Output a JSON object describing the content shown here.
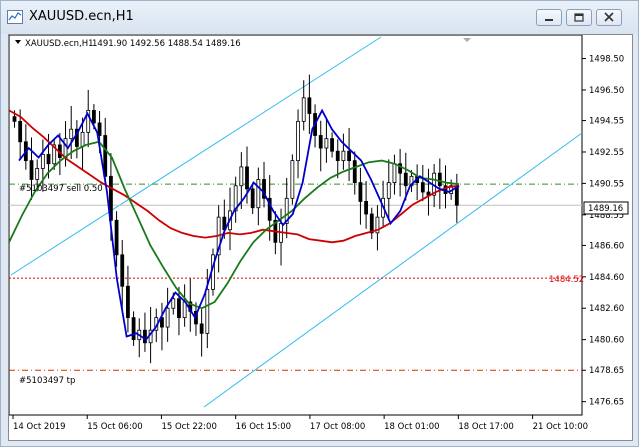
{
  "window": {
    "title": "XAUUSD.ecn,H1",
    "buttons": [
      "minimize",
      "restore",
      "close"
    ]
  },
  "chart_info": {
    "symbol_tf": "XAUUSD.ecn,H1",
    "ohlc": "1491.90 1492.56 1488.54 1489.16"
  },
  "order_lines": {
    "sell_label": "#5103497 sell 0.50",
    "tp_label": "#5103497 tp"
  },
  "price_labels": {
    "current": "1489.16",
    "alert": "1484.52"
  },
  "colors": {
    "candle": "#000000",
    "ma_red": "#cc0000",
    "ma_green": "#1a7a1a",
    "ma_blue": "#0000cc",
    "channel": "#33bbee",
    "sell_line": "#2f8f2f",
    "tp_line": "#cc3300",
    "alert_line": "#dd0000"
  },
  "chart_data": {
    "type": "candlestick",
    "symbol": "XAUUSD.ecn",
    "timeframe": "H1",
    "ylim": [
      1475.8,
      1500.0
    ],
    "y_ticks": [
      "1498.50",
      "1496.50",
      "1494.55",
      "1492.55",
      "1490.55",
      "1488.55",
      "1486.60",
      "1484.60",
      "1482.60",
      "1480.60",
      "1478.65",
      "1476.65"
    ],
    "x_ticks": [
      "14 Oct 2019",
      "15 Oct 06:00",
      "15 Oct 22:00",
      "16 Oct 15:00",
      "17 Oct 08:00",
      "18 Oct 01:00",
      "18 Oct 17:00",
      "21 Oct 10:00"
    ],
    "current_price": 1489.16,
    "levels": {
      "sell_entry": 1490.5,
      "take_profit": 1478.65,
      "alert": 1484.52,
      "current": 1489.16
    },
    "closes": [
      1494.5,
      1493.2,
      1492.0,
      1490.8,
      1491.5,
      1492.4,
      1491.8,
      1493.0,
      1492.2,
      1493.4,
      1494.0,
      1492.9,
      1493.8,
      1495.2,
      1494.4,
      1493.6,
      1491.0,
      1488.2,
      1486.0,
      1484.0,
      1482.0,
      1480.6,
      1481.2,
      1480.4,
      1481.2,
      1482.0,
      1481.4,
      1482.6,
      1483.2,
      1482.0,
      1483.0,
      1482.4,
      1481.6,
      1481.0,
      1483.8,
      1486.0,
      1488.4,
      1487.6,
      1488.8,
      1490.4,
      1491.6,
      1490.2,
      1489.0,
      1490.8,
      1489.6,
      1488.2,
      1486.8,
      1488.0,
      1489.6,
      1492.0,
      1494.5,
      1496.0,
      1495.0,
      1493.6,
      1492.8,
      1493.4,
      1492.6,
      1492.0,
      1492.6,
      1492.0,
      1490.6,
      1489.4,
      1488.6,
      1487.4,
      1488.4,
      1489.6,
      1490.6,
      1491.8,
      1491.2,
      1490.4,
      1491.0,
      1490.6,
      1490.0,
      1489.8,
      1491.2,
      1490.4,
      1489.9,
      1490.4,
      1489.16
    ],
    "series": [
      {
        "name": "",
        "color": "red",
        "values": [
          1495.2,
          1494.8,
          1494.1,
          1493.5,
          1492.8,
          1492.1,
          1491.6,
          1491.1,
          1490.6,
          1490.2,
          1489.8,
          1489.3,
          1488.8,
          1488.2,
          1487.7,
          1487.4,
          1487.2,
          1487.1,
          1487.2,
          1487.4,
          1487.3,
          1487.4,
          1487.6,
          1487.5,
          1487.4,
          1487.3,
          1487.0,
          1486.9,
          1486.8,
          1486.9,
          1487.2,
          1487.4,
          1487.6,
          1488.0,
          1488.6,
          1489.2,
          1489.6,
          1490.0,
          1490.3,
          1490.4
        ]
      },
      {
        "name": "",
        "color": "green",
        "values": [
          1486.8,
          1488.5,
          1490.0,
          1491.2,
          1492.0,
          1492.6,
          1493.0,
          1493.2,
          1492.2,
          1490.2,
          1488.4,
          1486.6,
          1485.2,
          1483.9,
          1482.9,
          1482.6,
          1483.0,
          1484.2,
          1485.6,
          1486.8,
          1487.6,
          1488.2,
          1488.8,
          1489.6,
          1490.3,
          1490.9,
          1491.3,
          1491.6,
          1491.9,
          1492.0,
          1491.8,
          1491.4,
          1490.9,
          1490.8,
          1490.6,
          1490.5
        ]
      },
      {
        "name": "",
        "color": "blue",
        "values": [
          1492.0,
          1492.8,
          1492.2,
          1493.0,
          1493.6,
          1492.8,
          1493.8,
          1495.0,
          1493.8,
          1490.0,
          1484.5,
          1480.8,
          1481.0,
          1480.6,
          1481.4,
          1482.6,
          1483.6,
          1483.0,
          1482.0,
          1483.5,
          1485.6,
          1487.5,
          1488.8,
          1489.6,
          1490.6,
          1490.0,
          1488.8,
          1487.9,
          1488.6,
          1490.6,
          1494.0,
          1495.2,
          1494.0,
          1493.2,
          1492.6,
          1492.0,
          1490.8,
          1489.4,
          1488.0,
          1488.8,
          1490.4,
          1491.0,
          1490.6,
          1490.2,
          1490.0,
          1490.4
        ]
      }
    ],
    "channel": "parallel lines, light blue",
    "grid": false
  }
}
